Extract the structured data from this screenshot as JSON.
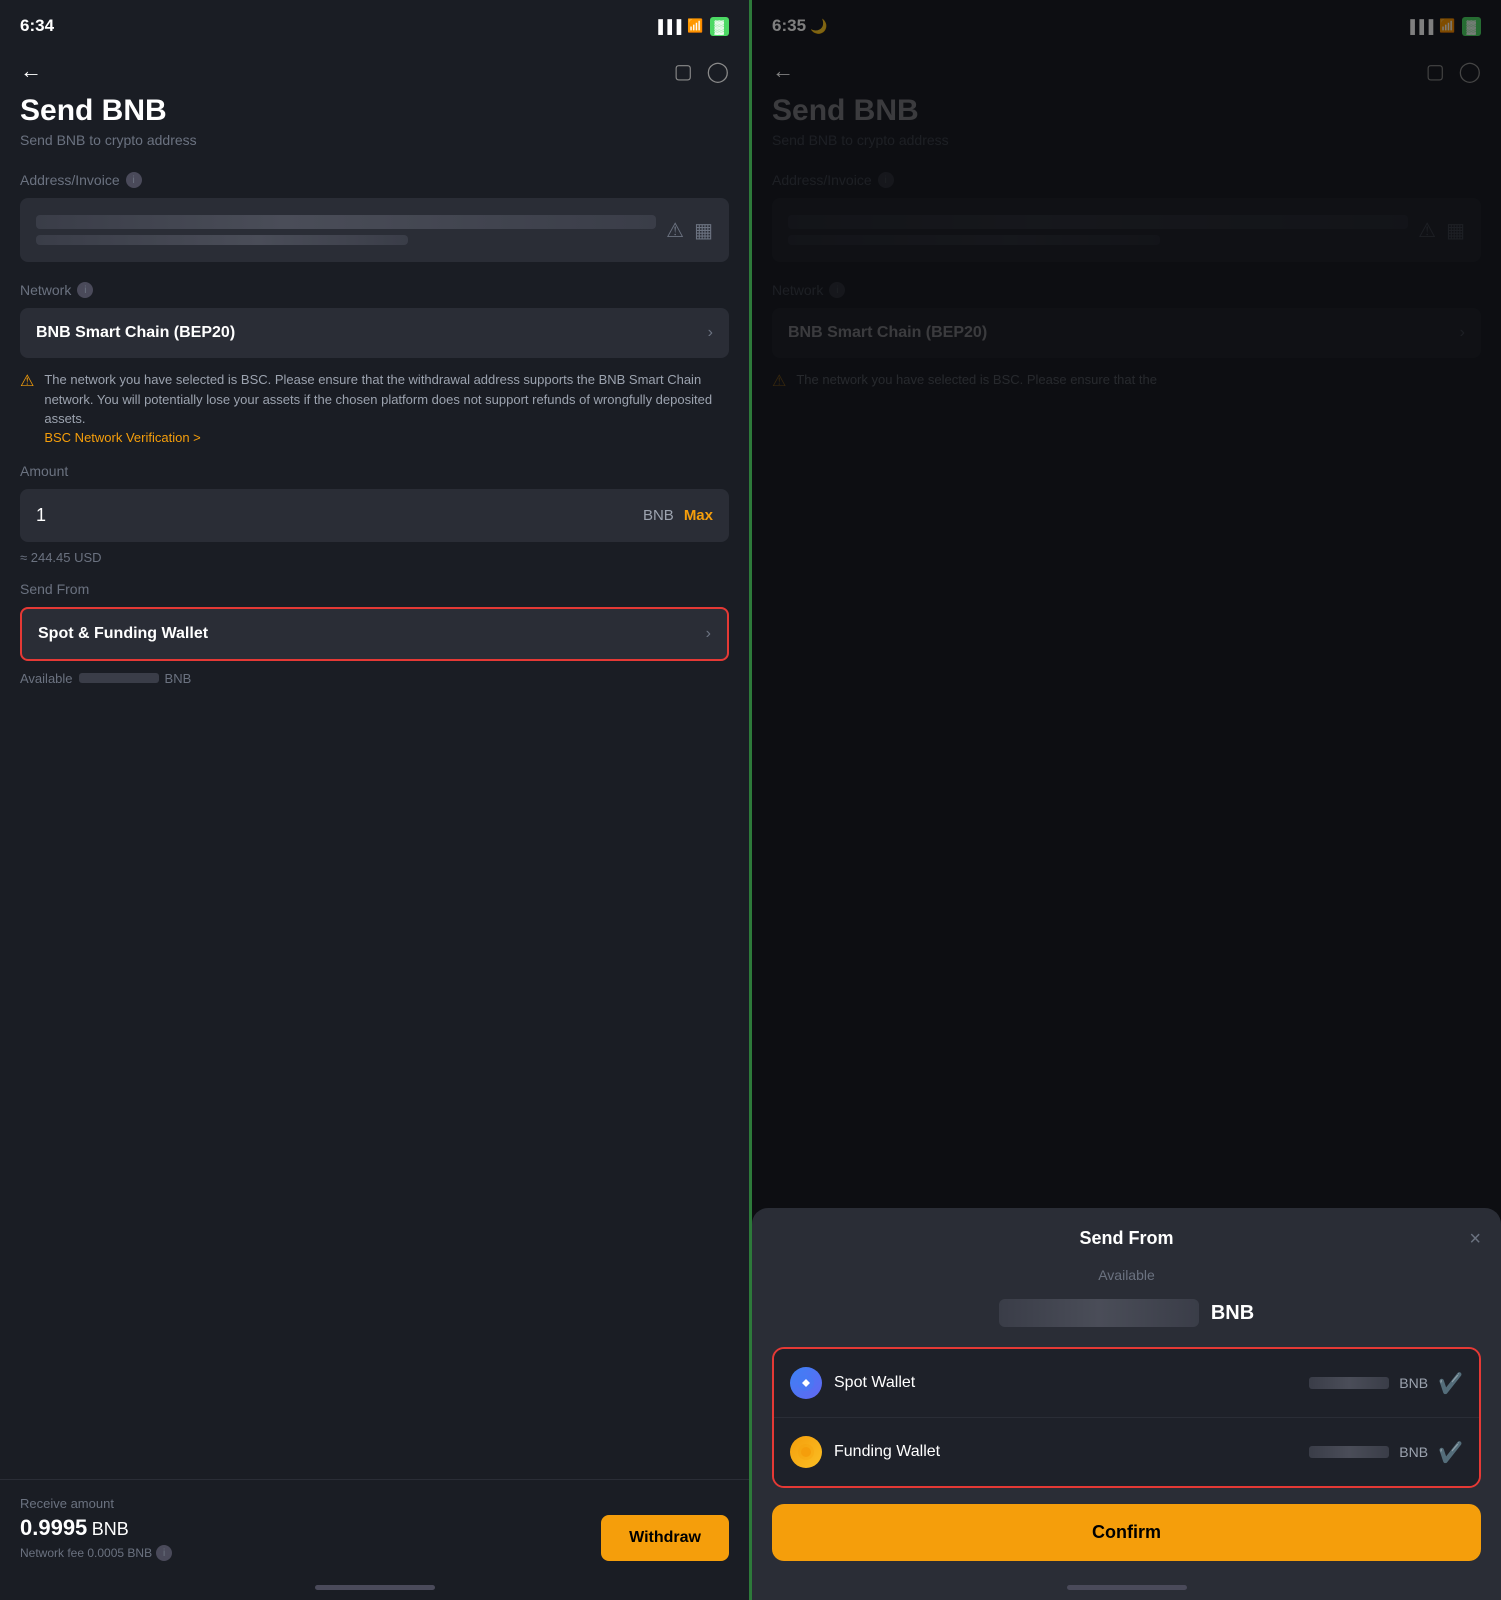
{
  "left_screen": {
    "status_time": "6:34",
    "nav_back": "←",
    "help_icon": "?",
    "clock_icon": "🕐",
    "page_title": "Send BNB",
    "page_subtitle": "Send BNB to crypto address",
    "address_label": "Address/Invoice",
    "network_label": "Network",
    "network_value": "BNB Smart Chain (BEP20)",
    "warning_text": "The network you have selected is BSC. Please ensure that the withdrawal address supports the BNB Smart Chain network. You will potentially lose your assets if the chosen platform does not support refunds of wrongfully deposited assets.",
    "warning_link": "BSC Network Verification >",
    "amount_label": "Amount",
    "amount_value": "1",
    "amount_currency": "BNB",
    "max_label": "Max",
    "usd_equiv": "≈ 244.45 USD",
    "send_from_label": "Send From",
    "send_from_value": "Spot & Funding Wallet",
    "available_label": "Available",
    "available_currency": "BNB",
    "receive_label": "Receive amount",
    "receive_amount": "0.9995",
    "receive_currency": "BNB",
    "network_fee": "Network fee 0.0005 BNB",
    "withdraw_label": "Withdraw"
  },
  "right_screen": {
    "status_time": "6:35",
    "nav_back": "←",
    "help_icon": "?",
    "clock_icon": "🕐",
    "page_title": "Send BNB",
    "page_subtitle": "Send BNB to crypto address",
    "address_label": "Address/Invoice",
    "network_label": "Network",
    "network_value": "BNB Smart Chain (BEP20)",
    "warning_text_short": "The network you have selected is BSC. Please ensure that the",
    "modal_title": "Send From",
    "modal_close": "×",
    "modal_available": "Available",
    "available_currency": "BNB",
    "spot_wallet_name": "Spot Wallet",
    "spot_wallet_currency": "BNB",
    "funding_wallet_name": "Funding Wallet",
    "funding_wallet_currency": "BNB",
    "confirm_label": "Confirm"
  }
}
